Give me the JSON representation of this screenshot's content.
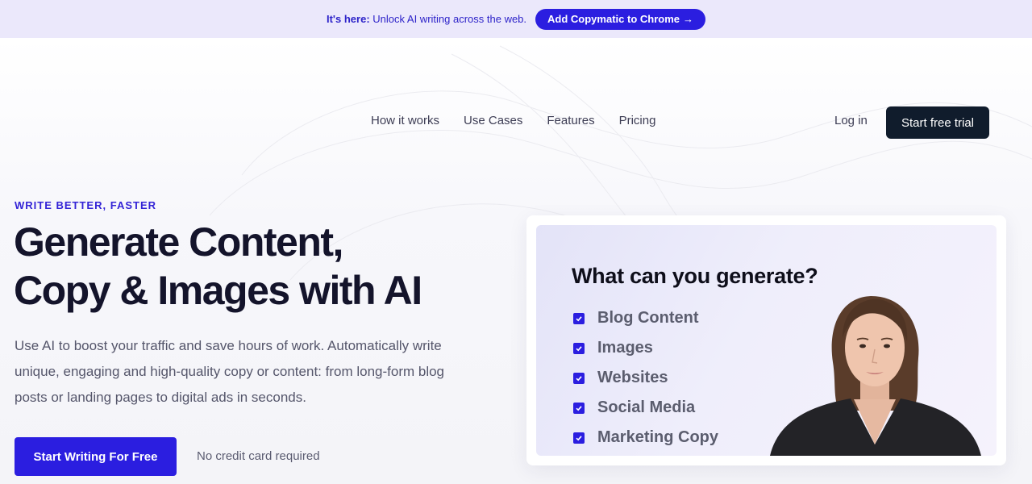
{
  "announcement": {
    "prefix": "It's here:",
    "message": "Unlock AI writing across the web.",
    "cta_label": "Add Copymatic to Chrome",
    "cta_arrow": "→"
  },
  "nav": {
    "links": [
      "How it works",
      "Use Cases",
      "Features",
      "Pricing"
    ],
    "login": "Log in",
    "trial": "Start free trial"
  },
  "hero": {
    "eyebrow": "WRITE BETTER, FASTER",
    "headline_line1": "Generate Content,",
    "headline_line2": "Copy & Images with AI",
    "subtext": "Use AI to boost your traffic and save hours of work. Automatically write unique, engaging and high-quality copy or content: from long-form blog posts or landing pages to digital ads in seconds.",
    "primary_cta": "Start Writing For Free",
    "note": "No credit card required"
  },
  "preview": {
    "title": "What can you generate?",
    "items": [
      "Blog Content",
      "Images",
      "Websites",
      "Social Media",
      "Marketing Copy"
    ],
    "check_icon": "checkbox-checked-icon"
  },
  "colors": {
    "accent": "#2b1ee0",
    "announcement_bg": "#ebe8fb",
    "dark_button": "#101c2c",
    "heading": "#14142b"
  }
}
